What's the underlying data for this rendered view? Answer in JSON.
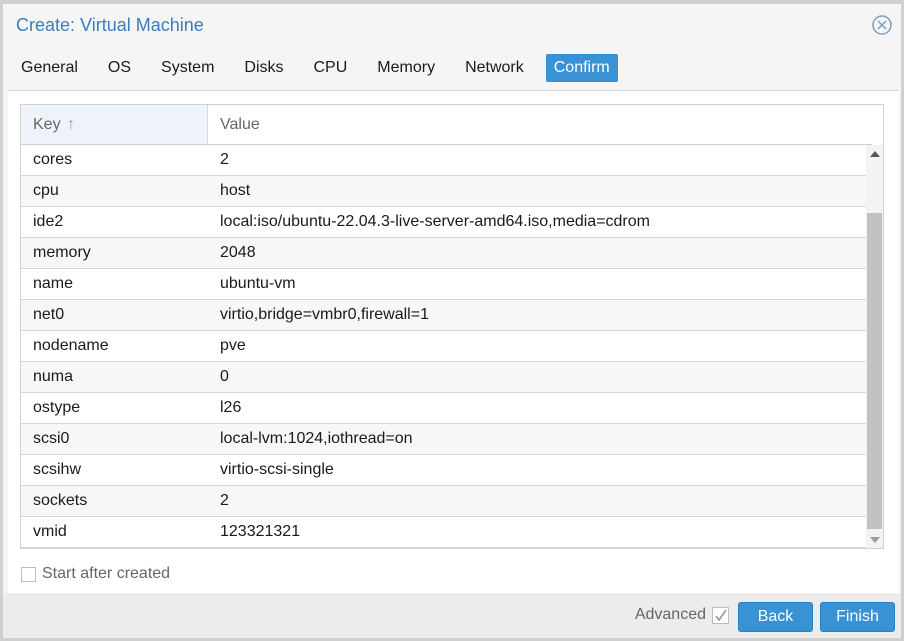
{
  "window": {
    "title": "Create: Virtual Machine",
    "close_icon": "close-circle-icon"
  },
  "tabs": [
    {
      "label": "General",
      "active": false
    },
    {
      "label": "OS",
      "active": false
    },
    {
      "label": "System",
      "active": false
    },
    {
      "label": "Disks",
      "active": false
    },
    {
      "label": "CPU",
      "active": false
    },
    {
      "label": "Memory",
      "active": false
    },
    {
      "label": "Network",
      "active": false
    },
    {
      "label": "Confirm",
      "active": true
    }
  ],
  "grid": {
    "columns": {
      "key": "Key",
      "key_sort_icon": "arrow-up-icon",
      "key_sort_glyph": "↑",
      "value": "Value"
    },
    "rows": [
      {
        "key": "cores",
        "value": "2"
      },
      {
        "key": "cpu",
        "value": "host"
      },
      {
        "key": "ide2",
        "value": "local:iso/ubuntu-22.04.3-live-server-amd64.iso,media=cdrom"
      },
      {
        "key": "memory",
        "value": "2048"
      },
      {
        "key": "name",
        "value": "ubuntu-vm"
      },
      {
        "key": "net0",
        "value": "virtio,bridge=vmbr0,firewall=1"
      },
      {
        "key": "nodename",
        "value": "pve"
      },
      {
        "key": "numa",
        "value": "0"
      },
      {
        "key": "ostype",
        "value": "l26"
      },
      {
        "key": "scsi0",
        "value": "local-lvm:1024,iothread=on"
      },
      {
        "key": "scsihw",
        "value": "virtio-scsi-single"
      },
      {
        "key": "sockets",
        "value": "2"
      },
      {
        "key": "vmid",
        "value": "123321321"
      }
    ]
  },
  "options": {
    "start_after_created": {
      "label": "Start after created",
      "checked": false
    }
  },
  "footer": {
    "advanced": {
      "label": "Advanced",
      "checked": true
    },
    "back_label": "Back",
    "finish_label": "Finish"
  },
  "colors": {
    "accent": "#3892d4",
    "title": "#3b7dbd"
  }
}
